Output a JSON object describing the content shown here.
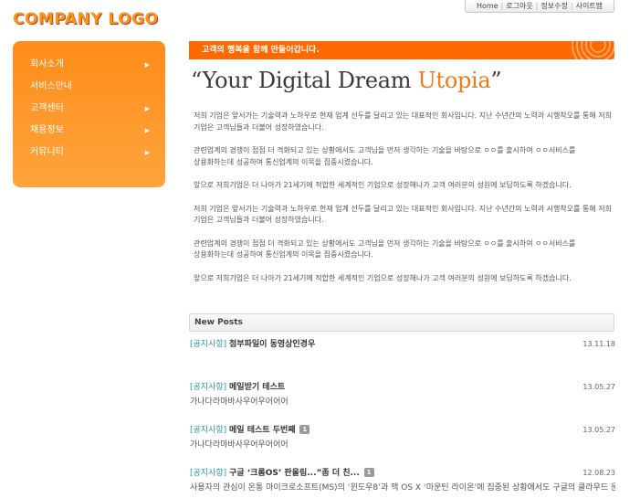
{
  "logo": "COMPANY LOGO",
  "topnav": [
    "Home",
    "로그아웃",
    "정보수정",
    "사이트맵"
  ],
  "sidebar": {
    "items": [
      {
        "label": "회사소개",
        "has_arrow": true
      },
      {
        "label": "서비스안내",
        "has_arrow": false
      },
      {
        "label": "고객센터",
        "has_arrow": true
      },
      {
        "label": "채용정보",
        "has_arrow": true
      },
      {
        "label": "커뮤니티",
        "has_arrow": true
      }
    ],
    "arrow_icon": "triangle-right-icon"
  },
  "banner": {
    "text": "고객의 행복을 함께 만들어갑니다."
  },
  "headline": {
    "main": "“Your Digital Dream ",
    "accent": "Utopia",
    "close": "”"
  },
  "paragraphs": [
    {
      "lines": [
        "저희 기업은 앞서가는 기술력과 노하우로 현재 업계 선두를 달리고 있는 대표적인 회사입니다. 지난 수년간의 노력과 시행착오를 통해 저희",
        "기업은 고객님들과 더불어 성장하였습니다."
      ]
    },
    {
      "lines": [
        "관련업계의 경쟁이 점점 더 격화되고 있는 상황에서도 고객님을 먼저 생각하는 기술을 바탕으로 ㅇㅇ를 출시하여 ㅇㅇ서비스를",
        "상용화하는데 성공하여 통신업계의 이목을 집중시켰습니다."
      ]
    },
    {
      "lines": [
        "앞으로 저희기업은 더 나아가 21세기에 적합한 세계적인 기업으로 성장해나가 고객 여러분의 성원에 보답하도록 하겠습니다."
      ]
    },
    {
      "lines": [
        "저희 기업은 앞서가는 기술력과 노하우로 현재 업계 선두를 달리고 있는 대표적인 회사입니다. 지난 수년간의 노력과 시행착오를 통해 저희",
        "기업은 고객님들과 더불어 성장하였습니다."
      ]
    },
    {
      "lines": [
        "관련업계의 경쟁이 점점 더 격화되고 있는 상황에서도 고객님을 먼저 생각하는 기술을 바탕으로 ㅇㅇ를 출시하여 ㅇㅇ서비스를",
        "상용화하는데 성공하여 통신업계의 이목을 집중시켰습니다."
      ]
    },
    {
      "lines": [
        "앞으로 저희기업은 더 나아가 21세기에 적합한 세계적인 기업으로 성장해나가 고객 여러분의 성원에 보답하도록 하겠습니다."
      ]
    }
  ],
  "new_posts": {
    "heading": "New Posts",
    "items": [
      {
        "category": "[공지사항]",
        "title": "첨부파일이 동영상인경우",
        "badge": "",
        "date": "13.11.18",
        "body": ""
      },
      {
        "category": "[공지사항]",
        "title": "메일받기 테스트",
        "badge": "",
        "date": "13.05.27",
        "body": "가나다라마바사우어우어어어"
      },
      {
        "category": "[공지사항]",
        "title": "메일 테스트 두번째",
        "badge": "1",
        "date": "13.05.27",
        "body": "가나다라마바사우어우어어어"
      },
      {
        "category": "[공지사항]",
        "title": "구글 ‘크롬OS’ 판올림...”좀 더 친...",
        "badge": "1",
        "date": "12.08.23",
        "body": "사용자의 관심이 온통 마이크로소프트(MS)의 ‘윈도우8’과 맥 OS X ‘마운틴 라이온’에 집중된 상황에서도 구글의 클라우드 운영체제(OS) ‘크롬OS’가 꾸준히 발전하고 있는 모양이다. 구글이 미국 현지시간으로 8월21일 크롬OS를 판올림했다."
      }
    ]
  }
}
